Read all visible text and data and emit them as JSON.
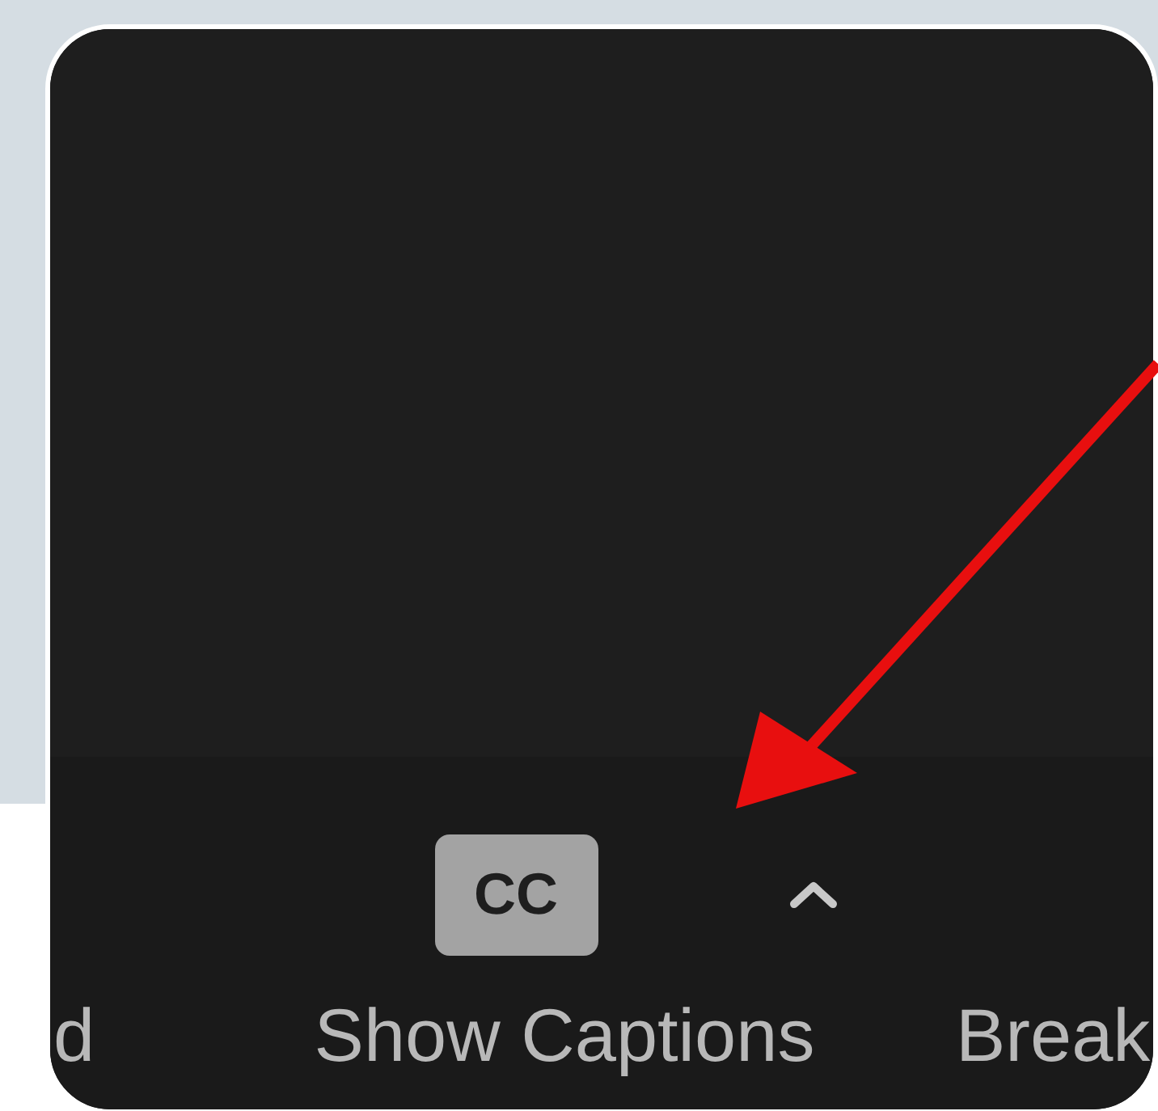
{
  "toolbar": {
    "items": [
      {
        "label": "d"
      },
      {
        "label": "Show Captions",
        "badge": "CC",
        "has_caret": true
      },
      {
        "label": "Break"
      }
    ]
  }
}
